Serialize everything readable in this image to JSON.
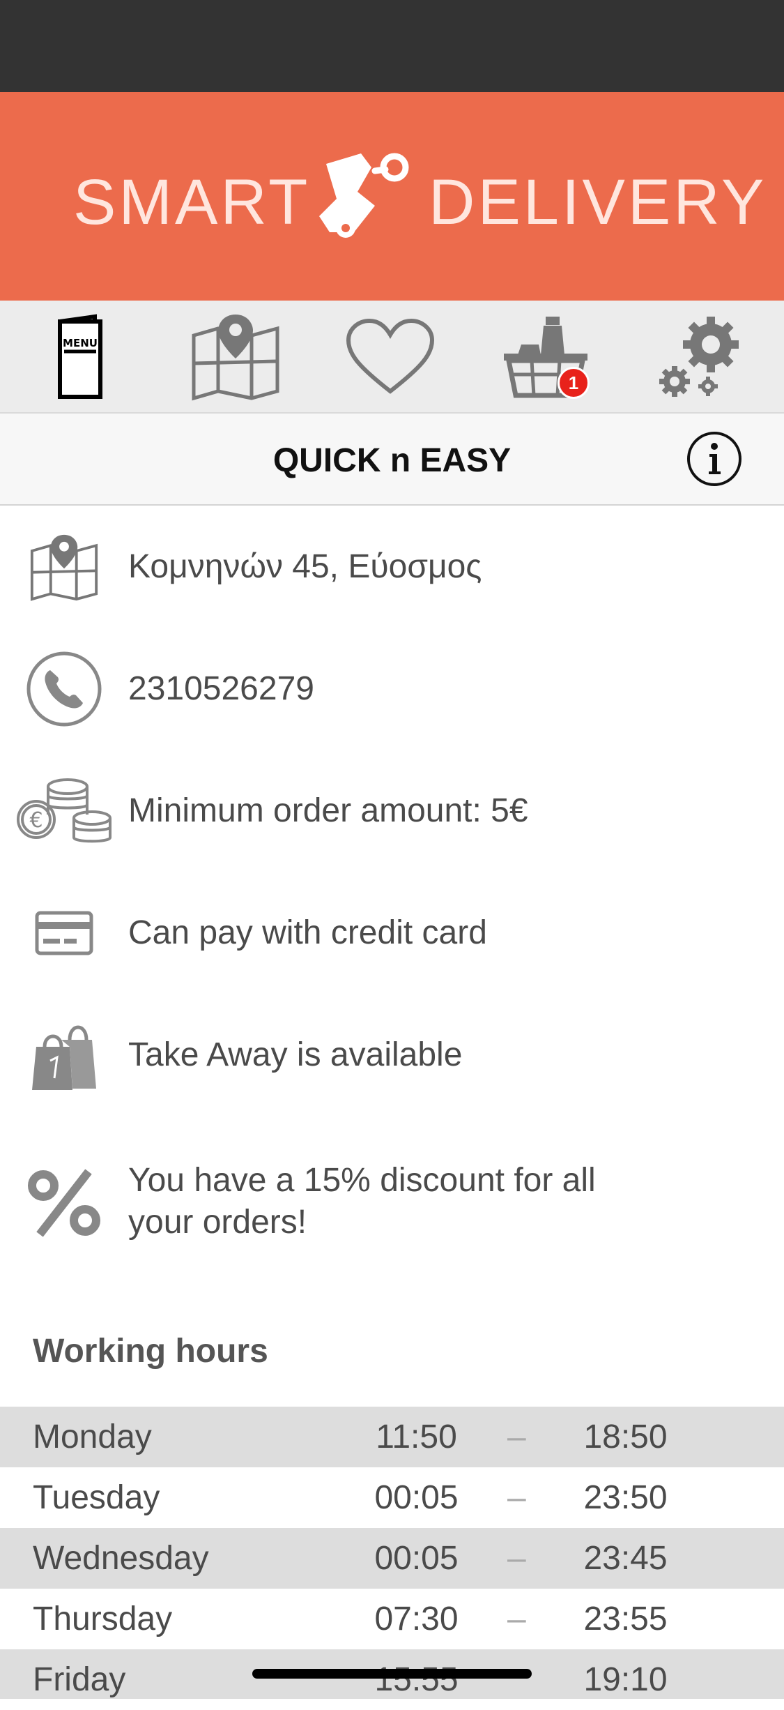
{
  "brand": {
    "left_word": "SMART",
    "right_word": "DELIVERY",
    "header_color": "#ec6b4c"
  },
  "toolbar": {
    "menu_icon_label": "MENU",
    "cart_badge_count": "1",
    "icons": [
      "menu-card-icon",
      "map-pin-icon",
      "heart-icon",
      "basket-icon",
      "gears-icon"
    ]
  },
  "store": {
    "title": "QUICK n EASY",
    "address": "Κομνηνών 45, Εύοσμος",
    "phone": "2310526279",
    "min_order": "Minimum order amount: 5€",
    "credit_card": "Can pay with credit card",
    "take_away": "Take Away is available",
    "discount": "You have a 15% discount for all your orders!"
  },
  "working_hours": {
    "title": "Working hours",
    "dash": "–",
    "rows": [
      {
        "day": "Monday",
        "open": "11:50",
        "close": "18:50"
      },
      {
        "day": "Tuesday",
        "open": "00:05",
        "close": "23:50"
      },
      {
        "day": "Wednesday",
        "open": "00:05",
        "close": "23:45"
      },
      {
        "day": "Thursday",
        "open": "07:30",
        "close": "23:55"
      },
      {
        "day": "Friday",
        "open": "15:55",
        "close": "19:10"
      }
    ]
  }
}
